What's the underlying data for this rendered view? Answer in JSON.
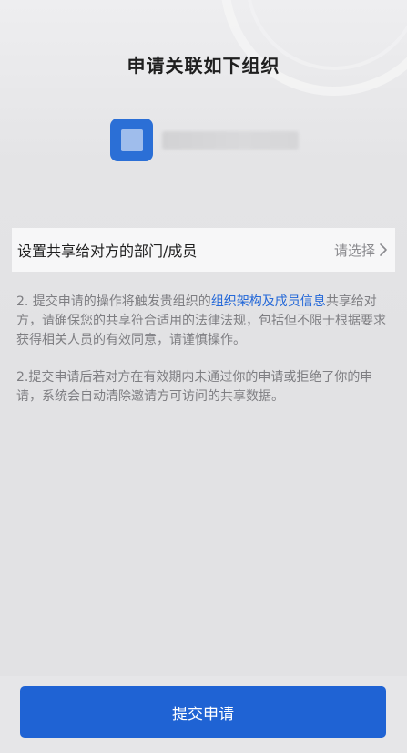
{
  "header": {
    "title": "申请关联如下组织"
  },
  "org": {
    "logo_icon": "org-logo-icon",
    "name": ""
  },
  "share_setting": {
    "label": "设置共享给对方的部门/成员",
    "action": "请选择",
    "chevron_icon": "chevron-right-icon"
  },
  "notes": {
    "note1_prefix": "2. 提交申请的操作将触发贵组织的",
    "note1_link": "组织架构及成员信息",
    "note1_suffix": "共享给对方，请确保您的共享符合适用的法律法规，包括但不限于根据要求获得相关人员的有效同意，请谨慎操作。",
    "note2": "2.提交申请后若对方在有效期内未通过你的申请或拒绝了你的申请，系统会自动清除邀请方可访问的共享数据。"
  },
  "footer": {
    "submit_label": "提交申请"
  },
  "colors": {
    "accent": "#1f63d4",
    "link": "#2468d8",
    "logo": "#2b6fd6"
  }
}
